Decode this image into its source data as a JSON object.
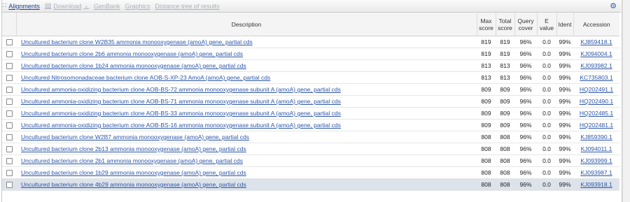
{
  "toolbar": {
    "alignments": "Alignments",
    "download": "Download",
    "genbank": "GenBank",
    "graphics": "Graphics",
    "distance_tree": "Distance tree of results"
  },
  "headers": [
    "Description",
    "Max score",
    "Total score",
    "Query cover",
    "E value",
    "Ident",
    "Accession"
  ],
  "rows": [
    {
      "desc": "Uncultured bacterium clone W2B35 ammonia monooxygenase (amoA) gene, partial cds",
      "max": "819",
      "total": "819",
      "cover": "96%",
      "e": "0.0",
      "ident": "99%",
      "acc": "KJ859418.1"
    },
    {
      "desc": "Uncultured bacterium clone 2b6 ammonia monooxygenase (amoA) gene, partial cds",
      "max": "819",
      "total": "819",
      "cover": "96%",
      "e": "0.0",
      "ident": "99%",
      "acc": "KJ094004.1"
    },
    {
      "desc": "Uncultured bacterium clone 1b24 ammonia monooxygenase (amoA) gene, partial cds",
      "max": "813",
      "total": "813",
      "cover": "96%",
      "e": "0.0",
      "ident": "99%",
      "acc": "KJ093982.1"
    },
    {
      "desc": "Uncultured Nitrosomonadaceae bacterium clone AOB-S-XP-23 AmoA (amoA) gene, partial cds",
      "max": "813",
      "total": "813",
      "cover": "96%",
      "e": "0.0",
      "ident": "99%",
      "acc": "KC735803.1"
    },
    {
      "desc": "Uncultured ammonia-oxidizing bacterium clone AOB-BS-72 ammonia monooxygenase subunit A (amoA) gene, partial cds",
      "max": "809",
      "total": "809",
      "cover": "96%",
      "e": "0.0",
      "ident": "99%",
      "acc": "HQ202491.1"
    },
    {
      "desc": "Uncultured ammonia-oxidizing bacterium clone AOB-BS-71 ammonia monooxygenase subunit A (amoA) gene, partial cds",
      "max": "809",
      "total": "809",
      "cover": "96%",
      "e": "0.0",
      "ident": "99%",
      "acc": "HQ202490.1"
    },
    {
      "desc": "Uncultured ammonia-oxidizing bacterium clone AOB-BS-33 ammonia monooxygenase subunit A (amoA) gene, partial cds",
      "max": "809",
      "total": "809",
      "cover": "96%",
      "e": "0.0",
      "ident": "99%",
      "acc": "HQ202485.1"
    },
    {
      "desc": "Uncultured ammonia-oxidizing bacterium clone AOB-BS-16 ammonia monooxygenase subunit A (amoA) gene, partial cds",
      "max": "809",
      "total": "809",
      "cover": "96%",
      "e": "0.0",
      "ident": "99%",
      "acc": "HQ202481.1"
    },
    {
      "desc": "Uncultured bacterium clone W2B7 ammonia monooxygenase (amoA) gene, partial cds",
      "max": "808",
      "total": "808",
      "cover": "96%",
      "e": "0.0",
      "ident": "99%",
      "acc": "KJ859390.1"
    },
    {
      "desc": "Uncultured bacterium clone 2b13 ammonia monooxygenase (amoA) gene, partial cds",
      "max": "808",
      "total": "808",
      "cover": "96%",
      "e": "0.0",
      "ident": "99%",
      "acc": "KJ094011.1"
    },
    {
      "desc": "Uncultured bacterium clone 2b1 ammonia monooxygenase (amoA) gene, partial cds",
      "max": "808",
      "total": "808",
      "cover": "96%",
      "e": "0.0",
      "ident": "99%",
      "acc": "KJ093999.1"
    },
    {
      "desc": "Uncultured bacterium clone 1b29 ammonia monooxygenase (amoA) gene, partial cds",
      "max": "808",
      "total": "808",
      "cover": "96%",
      "e": "0.0",
      "ident": "99%",
      "acc": "KJ093987.1"
    },
    {
      "desc": "Uncultured bacterium clone 4b29 ammonia monooxygenase (amoA) gene, partial cds",
      "max": "808",
      "total": "808",
      "cover": "96%",
      "e": "0.0",
      "ident": "99%",
      "acc": "KJ093918.1",
      "selected": true
    }
  ]
}
